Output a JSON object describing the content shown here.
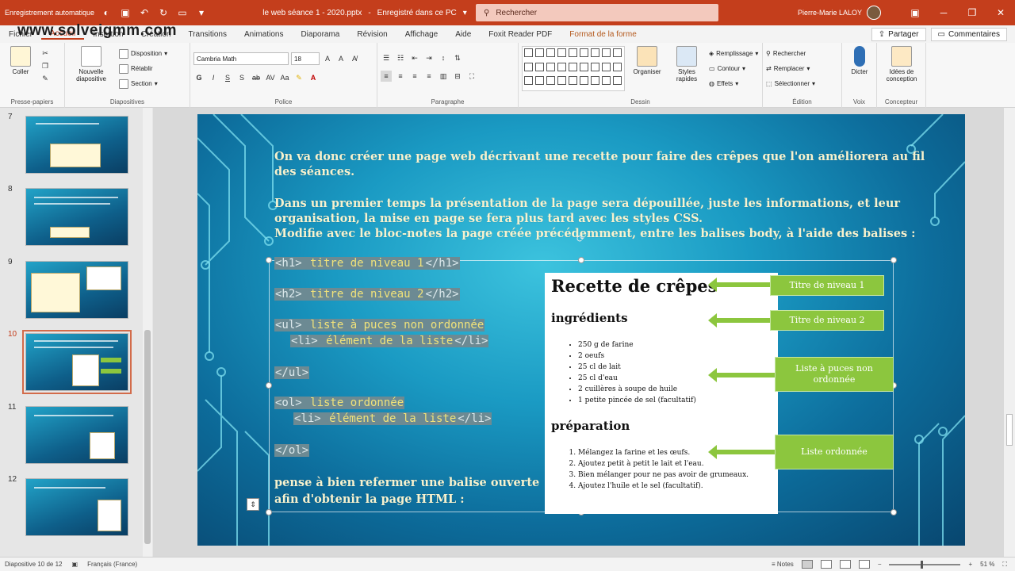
{
  "watermark": "www.solveigmm.com",
  "titlebar": {
    "autosave_text": "Enregistrement automatique",
    "document": "le web séance 1 - 2020.pptx",
    "saved_status": "Enregistré dans ce PC",
    "search_placeholder": "Rechercher",
    "user": "Pierre-Marie LALOY"
  },
  "tabs": [
    "Fichier",
    "Accueil",
    "Insertion",
    "Création",
    "Transitions",
    "Animations",
    "Diaporama",
    "Révision",
    "Affichage",
    "Aide",
    "Foxit Reader PDF",
    "Format de la forme"
  ],
  "tabs_right": {
    "share": "Partager",
    "comments": "Commentaires"
  },
  "ribbon": {
    "clipboard": {
      "paste": "Coller",
      "group": "Presse-papiers"
    },
    "slides": {
      "new_slide": "Nouvelle diapositive",
      "layout": "Disposition",
      "reset": "Rétablir",
      "section": "Section",
      "group": "Diapositives"
    },
    "font": {
      "family": "Cambria Math",
      "size": "18",
      "group": "Police",
      "case": "Aa"
    },
    "paragraph": {
      "group": "Paragraphe"
    },
    "drawing": {
      "arrange": "Organiser",
      "quick_styles": "Styles rapides",
      "fill": "Remplissage",
      "outline": "Contour",
      "effects": "Effets",
      "group": "Dessin"
    },
    "editing": {
      "find": "Rechercher",
      "replace": "Remplacer",
      "select": "Sélectionner",
      "group": "Édition"
    },
    "voice": {
      "dictate": "Dicter",
      "group": "Voix"
    },
    "designer": {
      "ideas": "Idées de conception",
      "group": "Concepteur"
    }
  },
  "thumbnails": [
    {
      "num": "7"
    },
    {
      "num": "8"
    },
    {
      "num": "9"
    },
    {
      "num": "10",
      "active": true
    },
    {
      "num": "11"
    },
    {
      "num": "12"
    }
  ],
  "slide": {
    "para1_line1": "On va donc créer une page web décrivant une recette pour faire des crêpes que l'on améliorera au fil",
    "para1_line2": "des séances.",
    "para2_line1": "Dans un premier temps la présentation de la page sera dépouillée, juste les informations, et leur",
    "para2_line2": "organisation, la mise en page se fera plus tard avec les styles CSS.",
    "para2_line3": "Modifie avec le bloc-notes la page créée précédemment, entre les balises body, à l'aide des balises :",
    "code": {
      "h1_open": "<h1>",
      "h1_text": " titre de niveau 1",
      "h1_close": "</h1>",
      "h2_open": "<h2>",
      "h2_text": " titre de niveau 2",
      "h2_close": "</h2>",
      "ul_open": "<ul>",
      "ul_text": " liste à puces non ordonnée",
      "li1_open": "<li>",
      "li1_text": " élément de la liste",
      "li1_close": "</li>",
      "ul_close": "</ul>",
      "ol_open": "<ol>",
      "ol_text": " liste ordonnée",
      "li2_open": "<li>",
      "li2_text": " élément de la liste",
      "li2_close": "</li>",
      "ol_close": "</ol>"
    },
    "footer_line1": "pense à bien refermer une balise ouverte",
    "footer_line2": "afin d'obtenir la page HTML :",
    "recipe": {
      "title": "Recette de crêpes",
      "ingredients_heading": "ingrédients",
      "ingredients": [
        "250 g de farine",
        "2 oeufs",
        "25 cl de lait",
        "25 cl d'eau",
        "2 cuillères à soupe de huile",
        "1 petite pincée de sel (facultatif)"
      ],
      "prep_heading": "préparation",
      "steps": [
        "Mélangez la farine et les œufs.",
        "Ajoutez petit à petit le lait et l'eau.",
        "Bien mélanger pour ne pas avoir de grumeaux.",
        "Ajoutez l'huile et le sel (facultatif)."
      ]
    },
    "callouts": {
      "title1": "Titre de niveau 1",
      "title2": "Titre de niveau 2",
      "ul": "Liste à puces non ordonnée",
      "ol": "Liste  ordonnée"
    },
    "colors": {
      "accent_green": "#8cc63e",
      "title_bar": "#c43e1c",
      "code_highlight": "#6c8a93"
    }
  },
  "statusbar": {
    "slide_info": "Diapositive 10 de 12",
    "language": "Français (France)",
    "notes": "Notes",
    "zoom": "51 %"
  }
}
